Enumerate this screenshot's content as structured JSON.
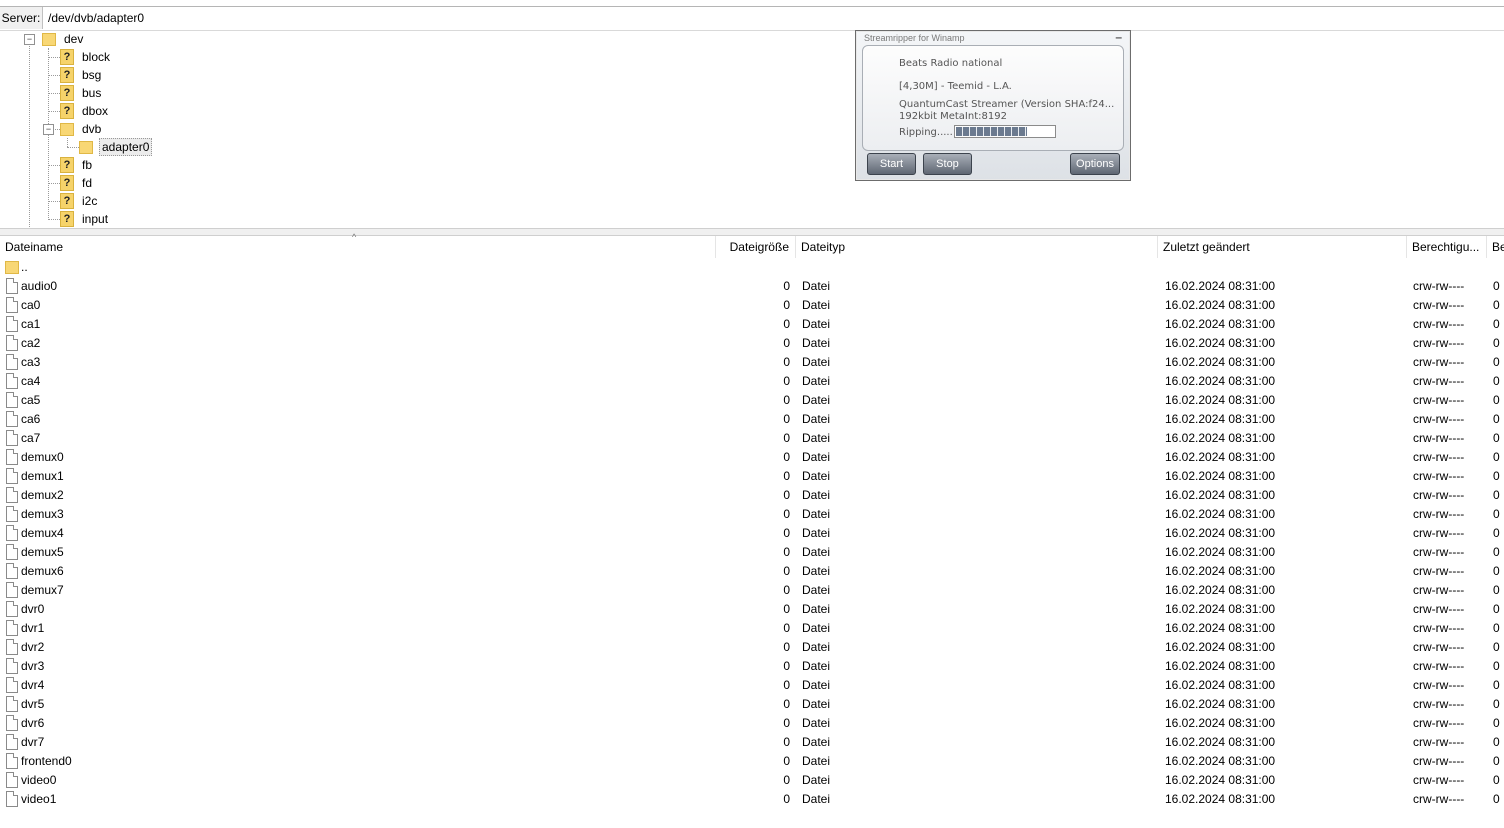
{
  "server": {
    "label": "Server:",
    "path": "/dev/dvb/adapter0"
  },
  "tree": {
    "nodes": [
      {
        "label": "dev",
        "icon": "folder-icon"
      },
      {
        "label": "block",
        "icon": "unknown-folder-icon"
      },
      {
        "label": "bsg",
        "icon": "unknown-folder-icon"
      },
      {
        "label": "bus",
        "icon": "unknown-folder-icon"
      },
      {
        "label": "dbox",
        "icon": "unknown-folder-icon"
      },
      {
        "label": "dvb",
        "icon": "folder-icon"
      },
      {
        "label": "adapter0",
        "icon": "folder-icon"
      },
      {
        "label": "fb",
        "icon": "unknown-folder-icon"
      },
      {
        "label": "fd",
        "icon": "unknown-folder-icon"
      },
      {
        "label": "i2c",
        "icon": "unknown-folder-icon"
      },
      {
        "label": "input",
        "icon": "unknown-folder-icon"
      }
    ],
    "expand_glyph": "⊟",
    "collapse_sign": "−"
  },
  "columns": {
    "name": "Dateiname",
    "size": "Dateigröße",
    "type": "Dateityp",
    "modified": "Zuletzt geändert",
    "perm": "Berechtigu...",
    "owner": "Be"
  },
  "parent_dir": "..",
  "files": [
    {
      "name": "audio0",
      "size": "0",
      "type": "Datei",
      "modified": "16.02.2024 08:31:00",
      "perm": "crw-rw----",
      "owner": "0"
    },
    {
      "name": "ca0",
      "size": "0",
      "type": "Datei",
      "modified": "16.02.2024 08:31:00",
      "perm": "crw-rw----",
      "owner": "0"
    },
    {
      "name": "ca1",
      "size": "0",
      "type": "Datei",
      "modified": "16.02.2024 08:31:00",
      "perm": "crw-rw----",
      "owner": "0"
    },
    {
      "name": "ca2",
      "size": "0",
      "type": "Datei",
      "modified": "16.02.2024 08:31:00",
      "perm": "crw-rw----",
      "owner": "0"
    },
    {
      "name": "ca3",
      "size": "0",
      "type": "Datei",
      "modified": "16.02.2024 08:31:00",
      "perm": "crw-rw----",
      "owner": "0"
    },
    {
      "name": "ca4",
      "size": "0",
      "type": "Datei",
      "modified": "16.02.2024 08:31:00",
      "perm": "crw-rw----",
      "owner": "0"
    },
    {
      "name": "ca5",
      "size": "0",
      "type": "Datei",
      "modified": "16.02.2024 08:31:00",
      "perm": "crw-rw----",
      "owner": "0"
    },
    {
      "name": "ca6",
      "size": "0",
      "type": "Datei",
      "modified": "16.02.2024 08:31:00",
      "perm": "crw-rw----",
      "owner": "0"
    },
    {
      "name": "ca7",
      "size": "0",
      "type": "Datei",
      "modified": "16.02.2024 08:31:00",
      "perm": "crw-rw----",
      "owner": "0"
    },
    {
      "name": "demux0",
      "size": "0",
      "type": "Datei",
      "modified": "16.02.2024 08:31:00",
      "perm": "crw-rw----",
      "owner": "0"
    },
    {
      "name": "demux1",
      "size": "0",
      "type": "Datei",
      "modified": "16.02.2024 08:31:00",
      "perm": "crw-rw----",
      "owner": "0"
    },
    {
      "name": "demux2",
      "size": "0",
      "type": "Datei",
      "modified": "16.02.2024 08:31:00",
      "perm": "crw-rw----",
      "owner": "0"
    },
    {
      "name": "demux3",
      "size": "0",
      "type": "Datei",
      "modified": "16.02.2024 08:31:00",
      "perm": "crw-rw----",
      "owner": "0"
    },
    {
      "name": "demux4",
      "size": "0",
      "type": "Datei",
      "modified": "16.02.2024 08:31:00",
      "perm": "crw-rw----",
      "owner": "0"
    },
    {
      "name": "demux5",
      "size": "0",
      "type": "Datei",
      "modified": "16.02.2024 08:31:00",
      "perm": "crw-rw----",
      "owner": "0"
    },
    {
      "name": "demux6",
      "size": "0",
      "type": "Datei",
      "modified": "16.02.2024 08:31:00",
      "perm": "crw-rw----",
      "owner": "0"
    },
    {
      "name": "demux7",
      "size": "0",
      "type": "Datei",
      "modified": "16.02.2024 08:31:00",
      "perm": "crw-rw----",
      "owner": "0"
    },
    {
      "name": "dvr0",
      "size": "0",
      "type": "Datei",
      "modified": "16.02.2024 08:31:00",
      "perm": "crw-rw----",
      "owner": "0"
    },
    {
      "name": "dvr1",
      "size": "0",
      "type": "Datei",
      "modified": "16.02.2024 08:31:00",
      "perm": "crw-rw----",
      "owner": "0"
    },
    {
      "name": "dvr2",
      "size": "0",
      "type": "Datei",
      "modified": "16.02.2024 08:31:00",
      "perm": "crw-rw----",
      "owner": "0"
    },
    {
      "name": "dvr3",
      "size": "0",
      "type": "Datei",
      "modified": "16.02.2024 08:31:00",
      "perm": "crw-rw----",
      "owner": "0"
    },
    {
      "name": "dvr4",
      "size": "0",
      "type": "Datei",
      "modified": "16.02.2024 08:31:00",
      "perm": "crw-rw----",
      "owner": "0"
    },
    {
      "name": "dvr5",
      "size": "0",
      "type": "Datei",
      "modified": "16.02.2024 08:31:00",
      "perm": "crw-rw----",
      "owner": "0"
    },
    {
      "name": "dvr6",
      "size": "0",
      "type": "Datei",
      "modified": "16.02.2024 08:31:00",
      "perm": "crw-rw----",
      "owner": "0"
    },
    {
      "name": "dvr7",
      "size": "0",
      "type": "Datei",
      "modified": "16.02.2024 08:31:00",
      "perm": "crw-rw----",
      "owner": "0"
    },
    {
      "name": "frontend0",
      "size": "0",
      "type": "Datei",
      "modified": "16.02.2024 08:31:00",
      "perm": "crw-rw----",
      "owner": "0"
    },
    {
      "name": "video0",
      "size": "0",
      "type": "Datei",
      "modified": "16.02.2024 08:31:00",
      "perm": "crw-rw----",
      "owner": "0"
    },
    {
      "name": "video1",
      "size": "0",
      "type": "Datei",
      "modified": "16.02.2024 08:31:00",
      "perm": "crw-rw----",
      "owner": "0"
    }
  ],
  "streamripper": {
    "title": "Streamripper for Winamp",
    "minimize": "–",
    "station": "Beats Radio national",
    "track": "[4,30M] - Teemid - L.A.",
    "server": "QuantumCast Streamer (Version  SHA:f24...",
    "bitrate": "192kbit   MetaInt:8192",
    "status": "Ripping.....",
    "progress": 0.72,
    "start_label": "Start",
    "stop_label": "Stop",
    "options_label": "Options"
  }
}
